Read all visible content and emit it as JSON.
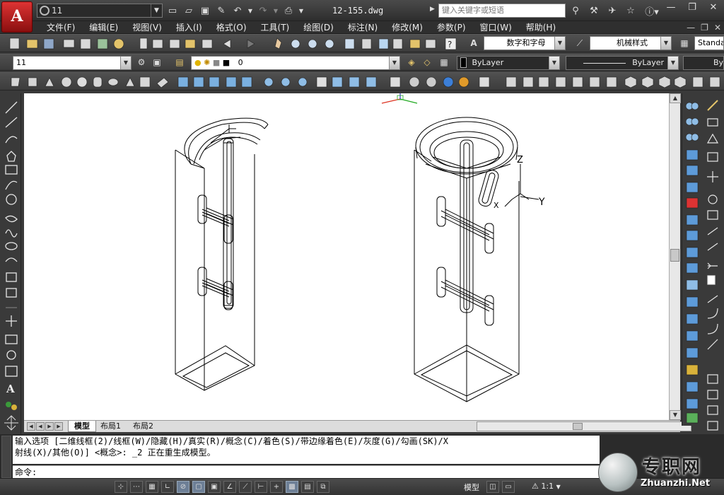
{
  "app": {
    "logo_letter": "A"
  },
  "workspace": {
    "value": "11"
  },
  "document": {
    "title": "12-155.dwg"
  },
  "search": {
    "placeholder": "键入关键字或短语"
  },
  "menu": {
    "items": [
      "文件(F)",
      "编辑(E)",
      "视图(V)",
      "插入(I)",
      "格式(O)",
      "工具(T)",
      "绘图(D)",
      "标注(N)",
      "修改(M)",
      "参数(P)",
      "窗口(W)",
      "帮助(H)"
    ]
  },
  "styles": {
    "text_style": "数字和字母",
    "dim_style": "机械样式",
    "table_style": "Standa"
  },
  "layers": {
    "ucs_value": "11",
    "current_layer": "0"
  },
  "properties": {
    "color": "ByLayer",
    "linetype": "ByLayer",
    "lineweight": "By"
  },
  "viewport": {
    "axis_z": "Z",
    "axis_y": "Y",
    "axis_x": "X"
  },
  "tabs": {
    "model": "模型",
    "layout1": "布局1",
    "layout2": "布局2"
  },
  "command": {
    "history_line1": "输入选项 [二维线框(2)/线框(W)/隐藏(H)/真实(R)/概念(C)/着色(S)/带边缘着色(E)/灰度(G)/勾画(SK)/X",
    "history_line2": "射线(X)/其他(O)] <概念>: _2 正在重生成模型。",
    "prompt": "命令:"
  },
  "status": {
    "model_label": "模型",
    "scale": "1:1"
  },
  "watermark": {
    "cn": "专职网",
    "url": "Zhuanzhi.Net"
  },
  "colors": {
    "accent": "#c62828",
    "background": "#3a3a3a",
    "canvas": "#ffffff"
  }
}
